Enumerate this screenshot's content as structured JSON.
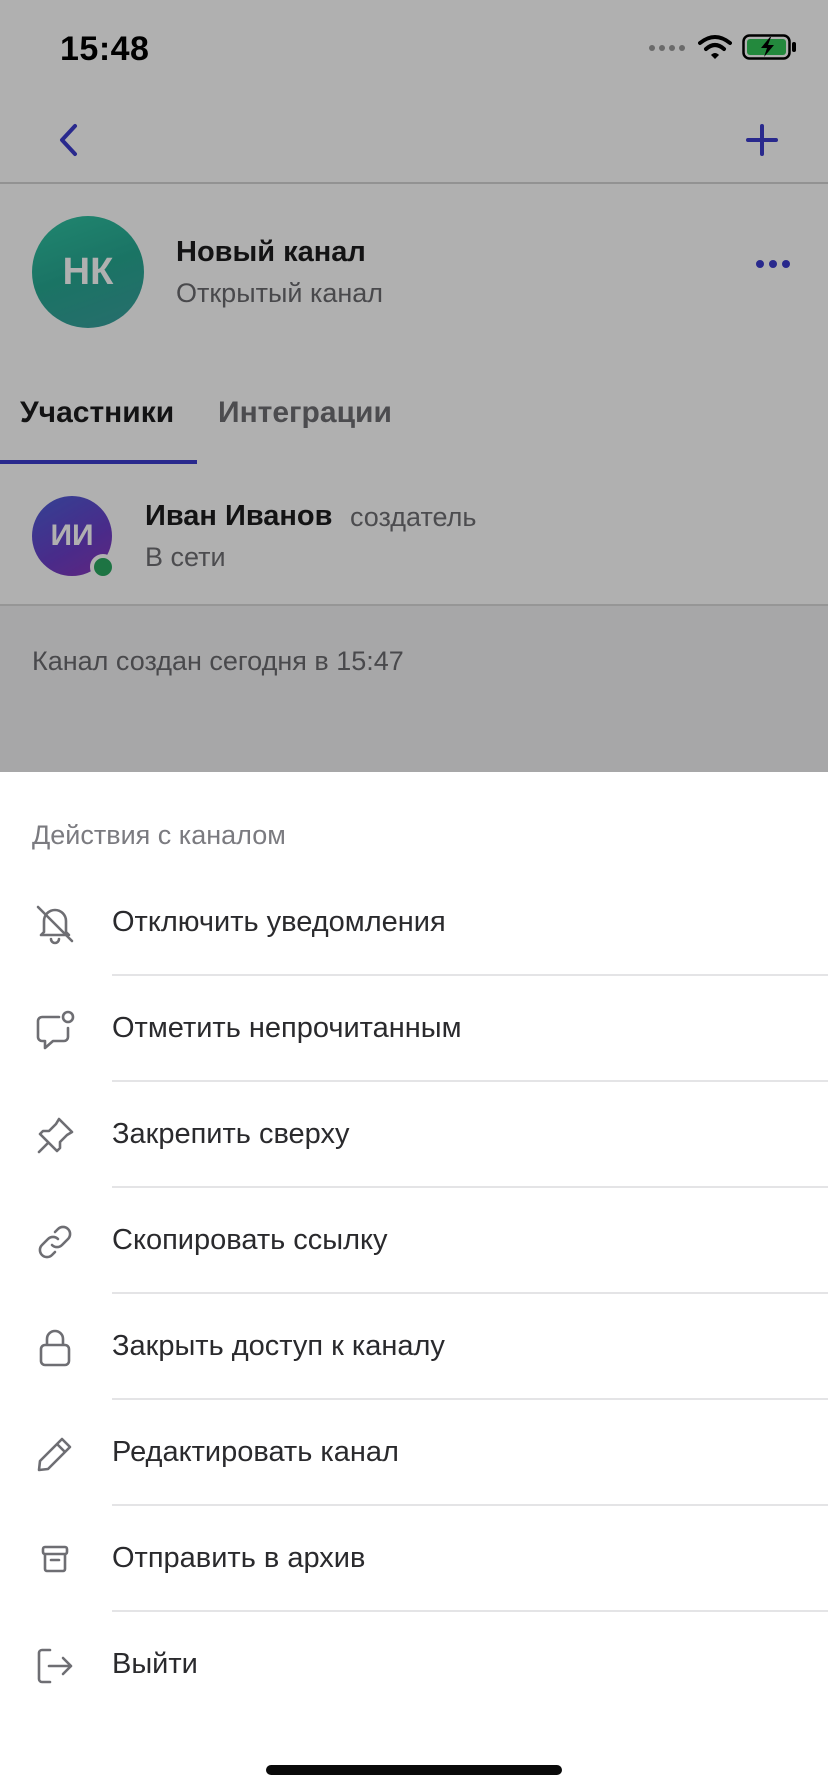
{
  "status_bar": {
    "time": "15:48"
  },
  "channel": {
    "avatar_initials": "НК",
    "name": "Новый канал",
    "type": "Открытый канал"
  },
  "tabs": [
    {
      "label": "Участники",
      "active": true
    },
    {
      "label": "Интеграции",
      "active": false
    }
  ],
  "member": {
    "avatar_initials": "ИИ",
    "name": "Иван Иванов",
    "role": "создатель",
    "status": "В сети"
  },
  "created_text": "Канал создан сегодня в 15:47",
  "sheet": {
    "title": "Действия с каналом",
    "items": [
      {
        "label": "Отключить уведомления",
        "icon": "bell-off-icon"
      },
      {
        "label": "Отметить непрочитанным",
        "icon": "message-unread-icon"
      },
      {
        "label": "Закрепить сверху",
        "icon": "pin-icon"
      },
      {
        "label": "Скопировать ссылку",
        "icon": "link-icon"
      },
      {
        "label": "Закрыть доступ к каналу",
        "icon": "lock-icon"
      },
      {
        "label": "Редактировать канал",
        "icon": "pencil-icon"
      },
      {
        "label": "Отправить в архив",
        "icon": "archive-icon"
      },
      {
        "label": "Выйти",
        "icon": "logout-icon"
      }
    ]
  },
  "colors": {
    "accent": "#3c3ccd",
    "online": "#2aa862",
    "channel_avatar": "#27a892",
    "member_avatar": "#5a4bd0"
  }
}
